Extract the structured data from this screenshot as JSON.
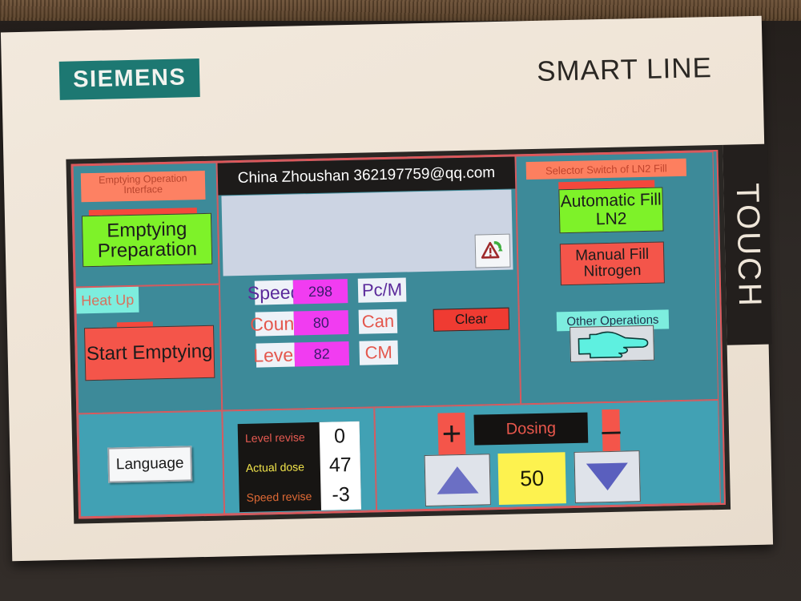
{
  "device": {
    "brand": "SIEMENS",
    "product_line": "SMART LINE",
    "bezel_label": "TOUCH",
    "brand_color": "#1d7872"
  },
  "screen": {
    "banner": "China  Zhoushan   362197759@qq.com",
    "background_color": "#3d8a99",
    "border_color": "#e0575a"
  },
  "emptying_panel": {
    "header": "Emptying Operation Interface",
    "preparation_button": "Emptying Preparation",
    "preparation_color": "#7ef229",
    "heat_up_label": "Heat Up",
    "start_button": "Start Emptying",
    "start_color": "#f4554a"
  },
  "process": {
    "alarm_ack_icon": "warning-acknowledge-icon",
    "rows": [
      {
        "label": "Speed",
        "value": "298",
        "unit": "Pc/M"
      },
      {
        "label": "Count",
        "value": "80",
        "unit": "Can"
      },
      {
        "label": "Level",
        "value": "82",
        "unit": "CM"
      }
    ],
    "clear_button": "Clear",
    "value_color": "#f13cf1"
  },
  "ln2_panel": {
    "header": "Selector Switch of LN2 Fill",
    "automatic_button": "Automatic Fill LN2",
    "automatic_color": "#7ef229",
    "manual_button": "Manual Fill Nitrogen",
    "manual_color": "#f4554a",
    "other_operations_label": "Other Operations",
    "hand_icon": "pointing-hand-icon"
  },
  "bottom": {
    "language_button": "Language",
    "revise": {
      "rows": [
        {
          "label": "Level revise",
          "value": "0",
          "color": "#e85b52"
        },
        {
          "label": "Actual dose",
          "value": "47",
          "color": "#f1e44b"
        },
        {
          "label": "Speed revise",
          "value": "-3",
          "color": "#e06a35"
        }
      ]
    },
    "dosing": {
      "title": "Dosing",
      "plus": "+",
      "minus": "–",
      "value": "50",
      "up_icon": "triangle-up-icon",
      "down_icon": "triangle-down-icon",
      "value_color": "#fdf24f"
    }
  }
}
